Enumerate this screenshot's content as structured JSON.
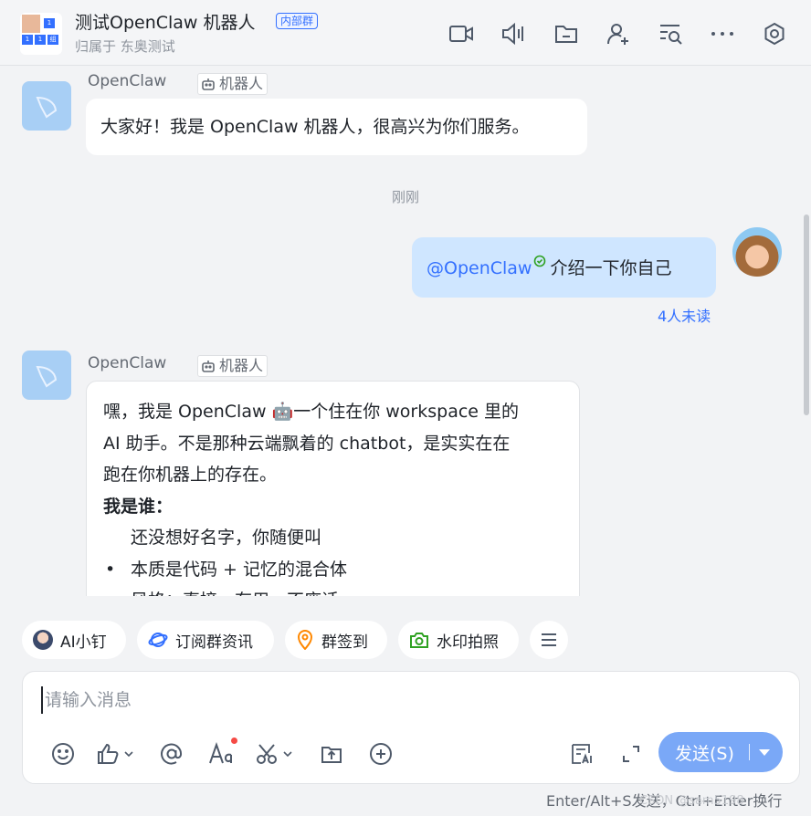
{
  "header": {
    "title": "测试OpenClaw 机器人",
    "tag": "内部群",
    "subtitle": "归属于 东奥测试",
    "avatar_cells": [
      "1",
      "1",
      "1",
      "1",
      "组"
    ]
  },
  "chat": {
    "messages": [
      {
        "sender": "OpenClaw",
        "tag": "机器人",
        "text": "大家好！我是 OpenClaw 机器人，很高兴为你们服务。"
      }
    ],
    "time_divider": "刚刚",
    "my_message": {
      "mention": "@OpenClaw",
      "text": "介绍一下你自己",
      "unread": "4人未读"
    },
    "reply": {
      "sender": "OpenClaw",
      "tag": "机器人",
      "line1": "嘿，我是 OpenClaw 🤖一个住在你 workspace 里的",
      "line2": "AI 助手。不是那种云端飘着的 chatbot，是实实在在",
      "line3": "跑在你机器上的存在。",
      "heading": "我是谁：",
      "item1": "还没想好名字，你随便叫",
      "item2": "本质是代码 + 记忆的混合体",
      "item3": "风格：直接、有用、不废话"
    }
  },
  "quick_actions": {
    "ai": "AI小钉",
    "subscribe": "订阅群资讯",
    "checkin": "群签到",
    "photo": "水印拍照"
  },
  "composer": {
    "placeholder": "请输入消息",
    "send_label": "发送(S)",
    "hint": "Enter/Alt+S发送，Ctrl+Enter换行",
    "watermark": "CSDN @sam5198"
  },
  "colors": {
    "accent": "#3370ff",
    "send_button": "#7aa8f7",
    "my_bubble": "#cfe6ff"
  }
}
